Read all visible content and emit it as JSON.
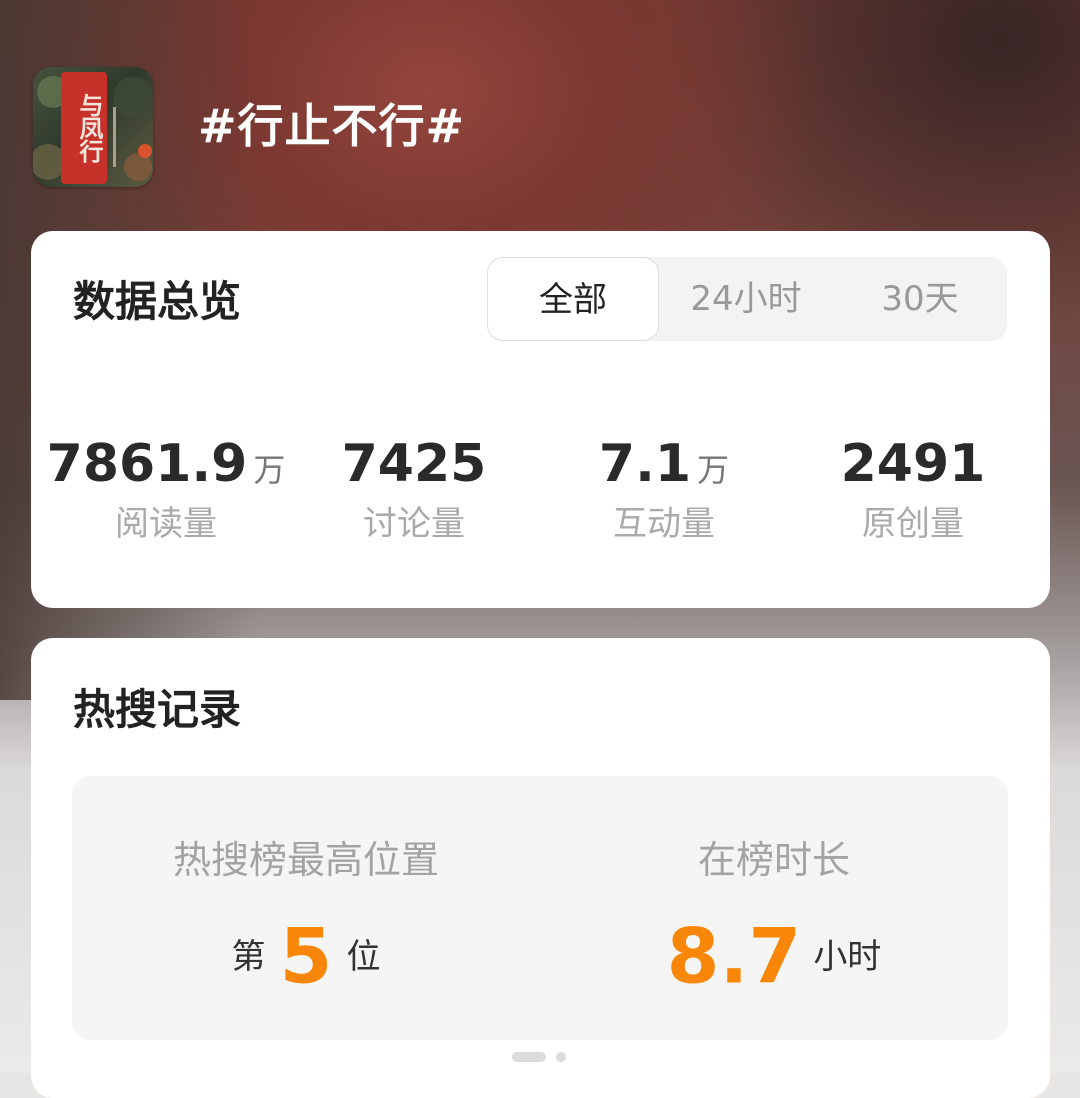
{
  "header": {
    "logo_text": "与凤行",
    "topic_title": "#行止不行#"
  },
  "overview": {
    "title": "数据总览",
    "tabs": [
      {
        "label": "全部",
        "active": true
      },
      {
        "label": "24小时",
        "active": false
      },
      {
        "label": "30天",
        "active": false
      }
    ],
    "stats": [
      {
        "value": "7861.9",
        "unit": "万",
        "label": "阅读量"
      },
      {
        "value": "7425",
        "unit": "",
        "label": "讨论量"
      },
      {
        "value": "7.1",
        "unit": "万",
        "label": "互动量"
      },
      {
        "value": "2491",
        "unit": "",
        "label": "原创量"
      }
    ]
  },
  "hot_search": {
    "title": "热搜记录",
    "rank": {
      "label": "热搜榜最高位置",
      "prefix": "第",
      "value": "5",
      "suffix": "位"
    },
    "duration": {
      "label": "在榜时长",
      "value": "8.7",
      "unit": "小时"
    }
  },
  "colors": {
    "accent_orange": "#f88709",
    "header_bg": "#7a3f38"
  },
  "pager": {
    "current": 1,
    "total": 2
  }
}
